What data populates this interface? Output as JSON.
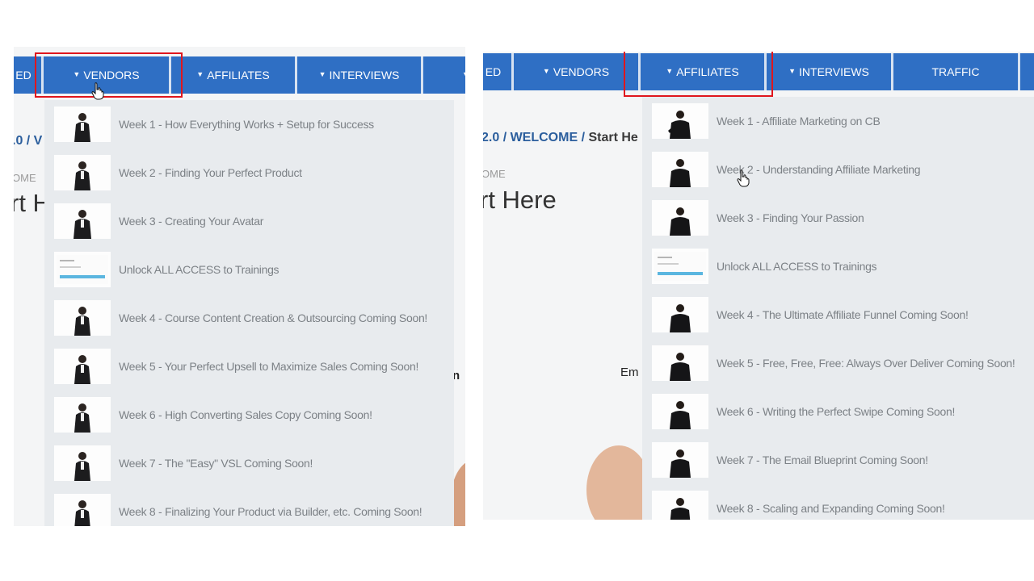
{
  "left_panel": {
    "nav": {
      "items": [
        {
          "label": "ED",
          "caret": false
        },
        {
          "label": "VENDORS",
          "caret": true
        },
        {
          "label": "AFFILIATES",
          "caret": true
        },
        {
          "label": "INTERVIEWS",
          "caret": true
        },
        {
          "label": "",
          "caret": true
        }
      ],
      "highlighted": "VENDORS"
    },
    "background": {
      "breadcrumb": ".0 / V",
      "subcrumb": "OME",
      "title": "rt H",
      "stray_text": "n"
    },
    "dropdown": {
      "items": [
        {
          "label": "Week 1 - How Everything Works + Setup for Success",
          "thumb": "presenter-woman"
        },
        {
          "label": "Week 2 - Finding Your Perfect Product",
          "thumb": "presenter-woman"
        },
        {
          "label": "Week 3 - Creating Your Avatar",
          "thumb": "presenter-woman"
        },
        {
          "label": "Unlock ALL ACCESS to Trainings",
          "thumb": "slide"
        },
        {
          "label": "Week 4 - Course Content Creation & Outsourcing Coming Soon!",
          "thumb": "presenter-woman"
        },
        {
          "label": "Week 5 - Your Perfect Upsell to Maximize Sales Coming Soon!",
          "thumb": "presenter-woman"
        },
        {
          "label": "Week 6 - High Converting Sales Copy Coming Soon!",
          "thumb": "presenter-woman"
        },
        {
          "label": "Week 7 - The \"Easy\" VSL Coming Soon!",
          "thumb": "presenter-woman"
        },
        {
          "label": "Week 8 - Finalizing Your Product via Builder, etc. Coming Soon!",
          "thumb": "presenter-woman"
        }
      ]
    }
  },
  "right_panel": {
    "nav": {
      "items": [
        {
          "label": "ED",
          "caret": false
        },
        {
          "label": "VENDORS",
          "caret": true
        },
        {
          "label": "AFFILIATES",
          "caret": true
        },
        {
          "label": "INTERVIEWS",
          "caret": true
        },
        {
          "label": "TRAFFIC",
          "caret": false
        }
      ],
      "highlighted": "AFFILIATES"
    },
    "background": {
      "breadcrumb_blue": "2.0 / WELCOME /",
      "breadcrumb_dark": " Start He",
      "subcrumb": "OME",
      "title": "rt Here",
      "stray_text": "Em"
    },
    "dropdown": {
      "items": [
        {
          "label": "Week 1 - Affiliate Marketing on CB",
          "thumb": "presenter-man"
        },
        {
          "label": "Week 2 - Understanding Affiliate Marketing",
          "thumb": "presenter-man"
        },
        {
          "label": "Week 3 - Finding Your Passion",
          "thumb": "presenter-man"
        },
        {
          "label": "Unlock ALL ACCESS to Trainings",
          "thumb": "slide"
        },
        {
          "label": "Week 4 - The Ultimate Affiliate Funnel Coming Soon!",
          "thumb": "presenter-man"
        },
        {
          "label": "Week 5 - Free, Free, Free: Always Over Deliver Coming Soon!",
          "thumb": "presenter-man"
        },
        {
          "label": "Week 6 - Writing the Perfect Swipe Coming Soon!",
          "thumb": "presenter-man"
        },
        {
          "label": "Week 7 - The Email Blueprint Coming Soon!",
          "thumb": "presenter-man"
        },
        {
          "label": "Week 8 - Scaling and Expanding Coming Soon!",
          "thumb": "presenter-man"
        }
      ]
    }
  },
  "colors": {
    "nav_blue": "#2f6fc4",
    "highlight_red": "#e0161d",
    "dropdown_bg": "#e8ebee",
    "item_text": "#7c8186",
    "breadcrumb_blue": "#2b5e9d"
  }
}
